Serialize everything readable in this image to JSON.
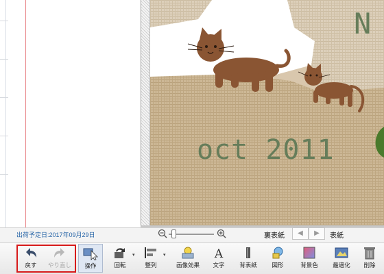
{
  "canvas": {
    "calendar_month": "N",
    "calendar_title": "oct 2011"
  },
  "status": {
    "delivery_label": "出荷予定日:2017年09月29日",
    "back_cover": "裏表紙",
    "front_cover": "表紙",
    "prev_symbol": "◀",
    "next_symbol": "▶"
  },
  "toolbar": {
    "undo": "戻す",
    "redo": "やり直し",
    "operate": "操作",
    "rotate": "回転",
    "align": "整列",
    "image_effect": "画像効果",
    "text": "文字",
    "back_paper": "背表紙",
    "shape": "図形",
    "bg_color": "背景色",
    "optimize": "最適化",
    "delete": "削除"
  },
  "colors": {
    "accent_red": "#d71a1a",
    "link_blue": "#2563a6",
    "calendar_green": "#667d5a",
    "cat_brown": "#8a5533"
  }
}
